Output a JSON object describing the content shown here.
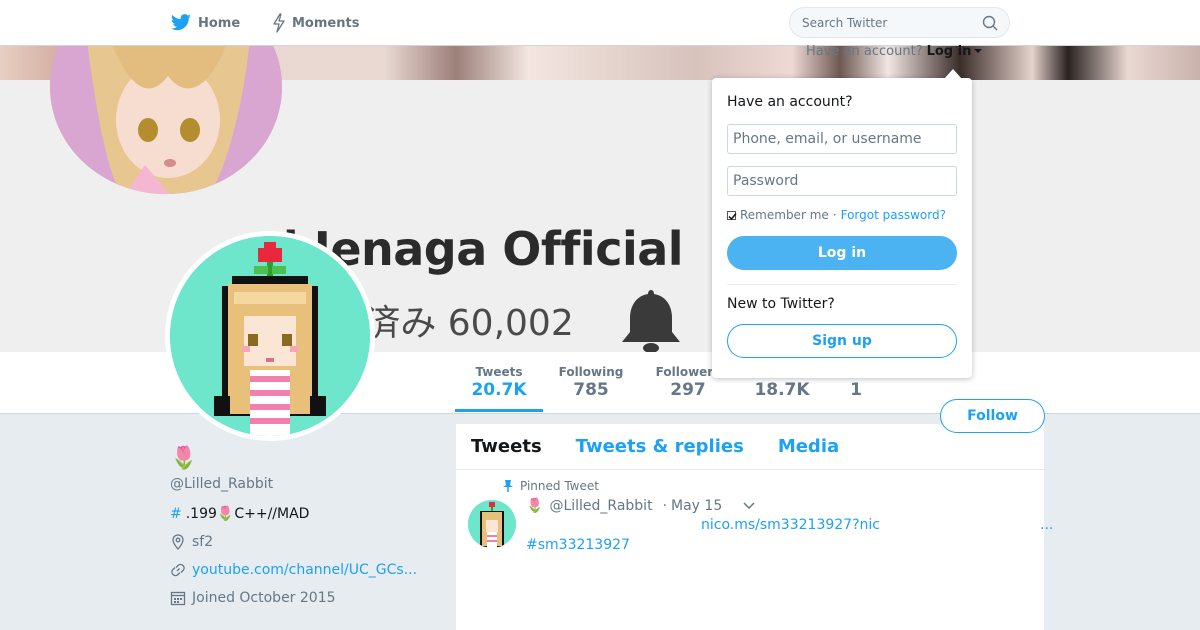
{
  "nav": {
    "home_label": "Home",
    "moments_label": "Moments",
    "search_placeholder": "Search Twitter"
  },
  "banner": {
    "title": "...i Ienaga Official",
    "count_text": "...済み 60,002"
  },
  "stats": [
    {
      "label": "Tweets",
      "value": "20.7K"
    },
    {
      "label": "Following",
      "value": "785"
    },
    {
      "label": "Followers",
      "value": "297"
    },
    {
      "label": "",
      "value": "18.7K"
    },
    {
      "label": "",
      "value": "1"
    }
  ],
  "follow_label": "Follow",
  "profile": {
    "emoji": "🌷",
    "screen_name": "@Lilled_Rabbit",
    "bio_hash": "#",
    "bio_text": ".199🌷C++//MAD",
    "location": "sf2",
    "url": "youtube.com/channel/UC_GCs...",
    "joined": "Joined October 2015"
  },
  "timeline": {
    "tabs": [
      "Tweets",
      "Tweets & replies",
      "Media"
    ],
    "pinned_label": "Pinned Tweet",
    "tweet": {
      "emoji": "🌷",
      "handle": "@Lilled_Rabbit",
      "date": "May 15",
      "link": "nico.ms/sm33213927?nic",
      "ellipsis": "...",
      "hashtag": "#sm33213927"
    }
  },
  "login": {
    "toggle_prefix": "Have an account?",
    "toggle_label": "Log in",
    "question": "Have an account?",
    "username_placeholder": "Phone, email, or username",
    "password_placeholder": "Password",
    "remember_label": "Remember me",
    "separator": "·",
    "forgot_label": "Forgot password?",
    "login_button": "Log in",
    "new_question": "New to Twitter?",
    "signup_button": "Sign up"
  },
  "colors": {
    "accent": "#1da1f2",
    "background": "#e6ecf0",
    "avatar_bg": "#6ee6cc"
  }
}
